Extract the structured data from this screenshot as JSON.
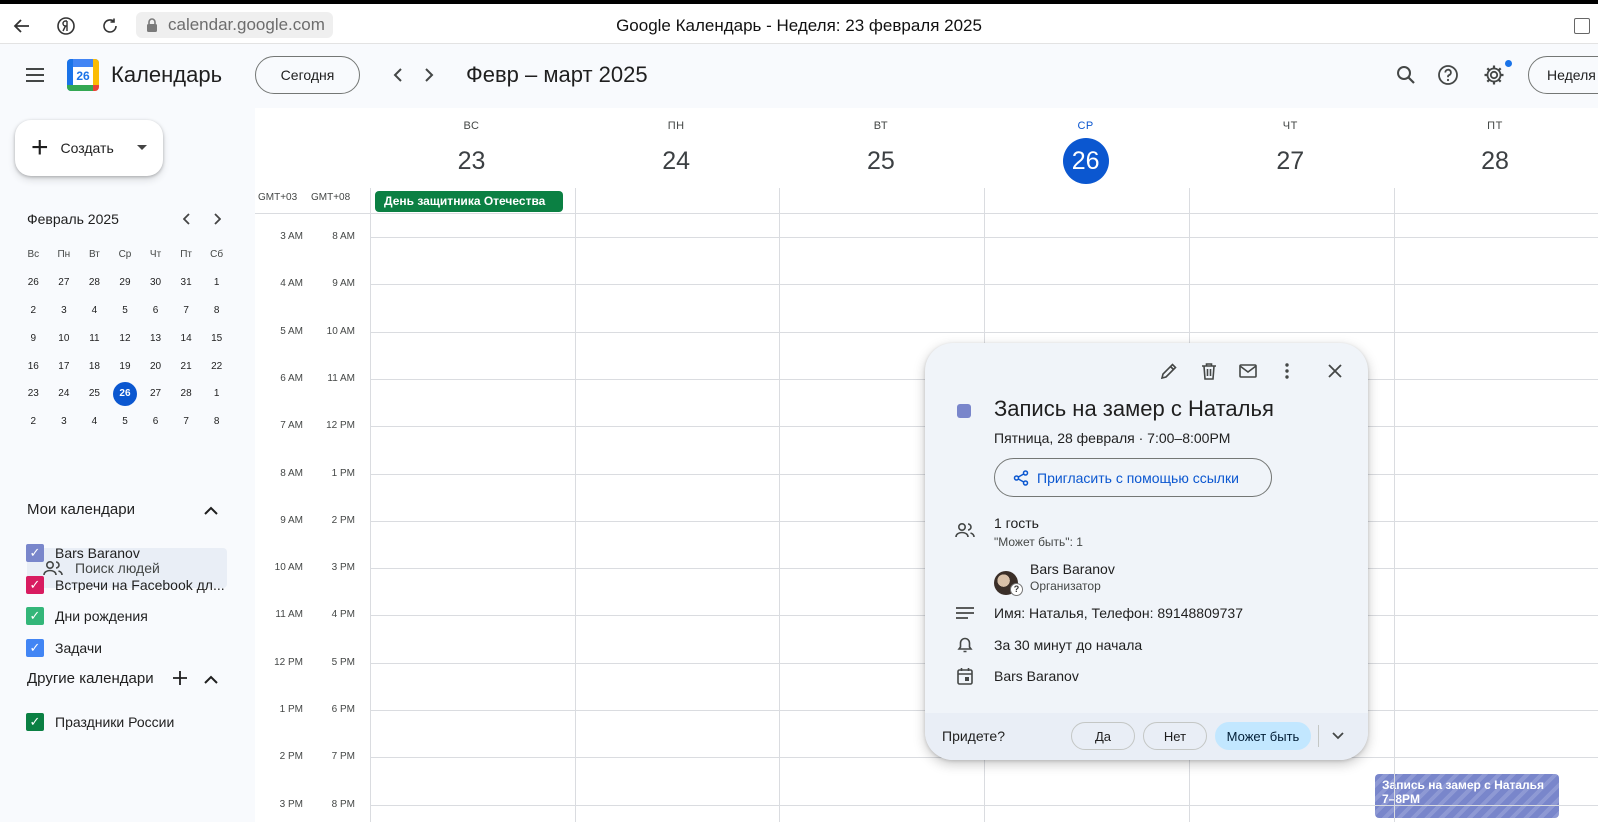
{
  "browser": {
    "url": "calendar.google.com",
    "tab_title": "Google Календарь - Неделя: 23 февраля 2025"
  },
  "header": {
    "app_name": "Календарь",
    "logo_day": "26",
    "today_label": "Сегодня",
    "period": "Февр – март 2025",
    "view_label": "Неделя"
  },
  "sidebar": {
    "create_label": "Создать",
    "mini_calendar": {
      "title": "Февраль 2025",
      "weekdays": [
        "Вс",
        "Пн",
        "Вт",
        "Ср",
        "Чт",
        "Пт",
        "Сб"
      ],
      "weeks": [
        [
          "26",
          "27",
          "28",
          "29",
          "30",
          "31",
          "1"
        ],
        [
          "2",
          "3",
          "4",
          "5",
          "6",
          "7",
          "8"
        ],
        [
          "9",
          "10",
          "11",
          "12",
          "13",
          "14",
          "15"
        ],
        [
          "16",
          "17",
          "18",
          "19",
          "20",
          "21",
          "22"
        ],
        [
          "23",
          "24",
          "25",
          "26",
          "27",
          "28",
          "1"
        ],
        [
          "2",
          "3",
          "4",
          "5",
          "6",
          "7",
          "8"
        ]
      ],
      "selected": "26"
    },
    "people_search_placeholder": "Поиск людей",
    "my_calendars_title": "Мои календари",
    "my_calendars": [
      {
        "label": "Bars Baranov",
        "color": "#7986cb"
      },
      {
        "label": "Встречи на Facebook дл...",
        "color": "#d81b60"
      },
      {
        "label": "Дни рождения",
        "color": "#33b679"
      },
      {
        "label": "Задачи",
        "color": "#4285f4"
      }
    ],
    "other_calendars_title": "Другие календари",
    "other_calendars": [
      {
        "label": "Праздники России",
        "color": "#0b8043"
      }
    ]
  },
  "week": {
    "days": [
      {
        "dow": "ВС",
        "num": "23"
      },
      {
        "dow": "ПН",
        "num": "24"
      },
      {
        "dow": "ВТ",
        "num": "25"
      },
      {
        "dow": "СР",
        "num": "26",
        "today": true
      },
      {
        "dow": "ЧТ",
        "num": "27"
      },
      {
        "dow": "ПТ",
        "num": "28"
      }
    ],
    "timezones": [
      "GMT+03",
      "GMT+08"
    ],
    "allday_event": "День защитника Отечества",
    "hours_primary": [
      "3 AM",
      "4 AM",
      "5 AM",
      "6 AM",
      "7 AM",
      "8 AM",
      "9 AM",
      "10 AM",
      "11 AM",
      "12 PM",
      "1 PM",
      "2 PM",
      "3 PM"
    ],
    "hours_secondary": [
      "8 AM",
      "9 AM",
      "10 AM",
      "11 AM",
      "12 PM",
      "1 PM",
      "2 PM",
      "3 PM",
      "4 PM",
      "5 PM",
      "6 PM",
      "7 PM",
      "8 PM"
    ],
    "event_block": {
      "title": "Запись на замер с Наталья",
      "time": "7–8PM"
    }
  },
  "popover": {
    "title": "Запись на замер с Наталья",
    "when": "Пятница, 28 февраля  ·  7:00–8:00PM",
    "invite_label": "Пригласить с помощью ссылки",
    "guests_count": "1 гость",
    "guests_sub": "\"Может быть\": 1",
    "organizer_name": "Bars Baranov",
    "organizer_role": "Организатор",
    "description": "Имя: Наталья, Телефон: 89148809737",
    "reminder": "За 30 минут до начала",
    "calendar": "Bars Baranov",
    "rsvp_question": "Придете?",
    "rsvp_yes": "Да",
    "rsvp_no": "Нет",
    "rsvp_maybe": "Может быть"
  },
  "colors": {
    "accent": "#0b57d0",
    "event": "#7986cb",
    "holiday": "#0b8043"
  }
}
